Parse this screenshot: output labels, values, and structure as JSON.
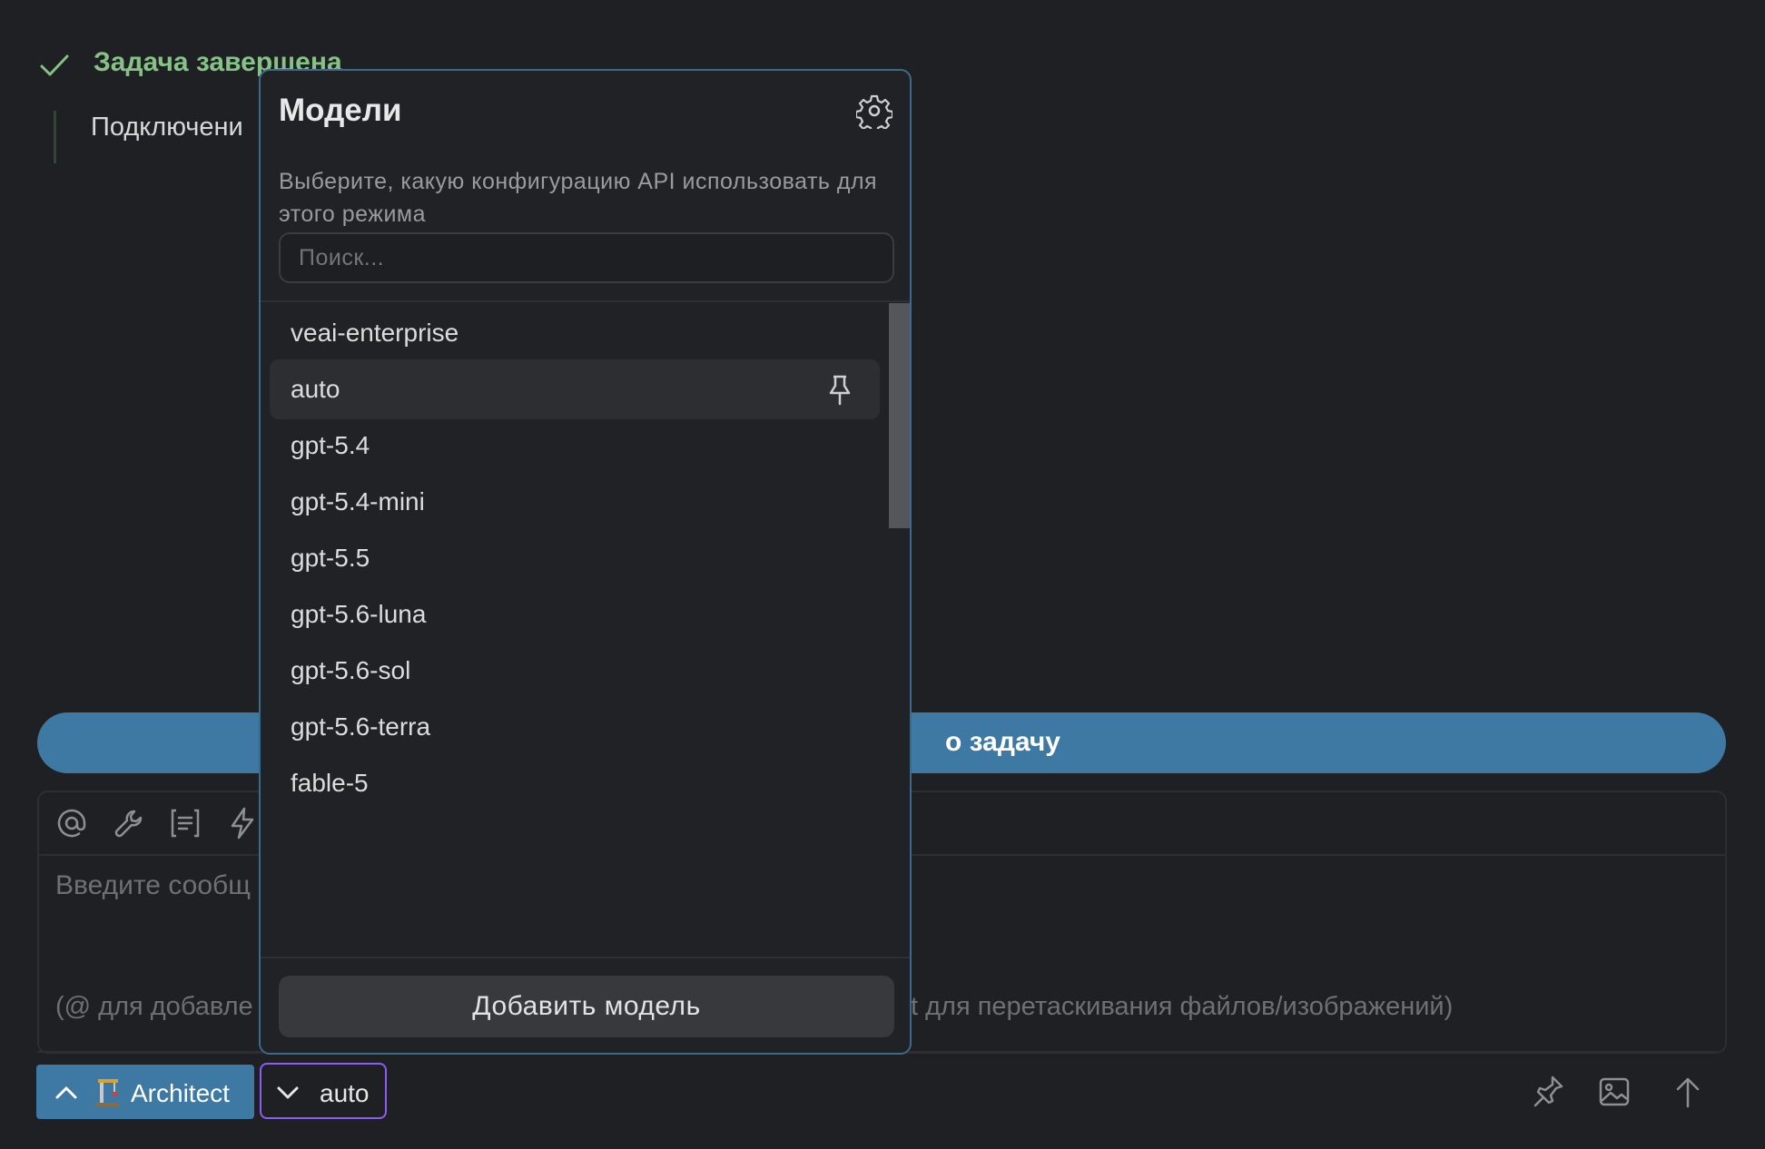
{
  "task": {
    "title": "Задача завершена",
    "text": "Подключени"
  },
  "new_task": {
    "label": "о задачу"
  },
  "composer": {
    "placeholder": "Введите сообщ",
    "hint_left": "(@ для добавле",
    "hint_right": "t для перетаскивания файлов/изображений)"
  },
  "mode": {
    "emoji": "🏗️",
    "label": "Architect"
  },
  "model_selector": {
    "label": "auto"
  },
  "popover": {
    "title": "Модели",
    "description": "Выберите, какую конфигурацию API использовать для этого режима",
    "search_placeholder": "Поиск...",
    "models": [
      {
        "label": "veai-enterprise"
      },
      {
        "label": "auto",
        "selected": true
      },
      {
        "label": "gpt-5.4"
      },
      {
        "label": "gpt-5.4-mini"
      },
      {
        "label": "gpt-5.5"
      },
      {
        "label": "gpt-5.6-luna"
      },
      {
        "label": "gpt-5.6-sol"
      },
      {
        "label": "gpt-5.6-terra"
      },
      {
        "label": "fable-5"
      }
    ],
    "add_button": "Добавить модель"
  },
  "colors": {
    "accent_blue": "#3d79a3",
    "success_green": "#86c285",
    "focus_purple": "#8b5cf6",
    "background": "#1f2023"
  }
}
